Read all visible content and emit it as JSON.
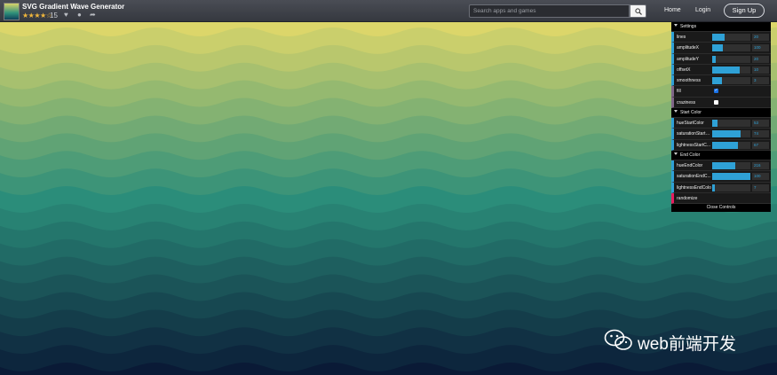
{
  "app": {
    "title": "SVG Gradient Wave Generator",
    "stars": "★★★★☆",
    "rating_count": "15",
    "icons": [
      "heart-icon",
      "info-icon",
      "share-icon"
    ]
  },
  "search": {
    "placeholder": "Search apps and games"
  },
  "nav": {
    "home": "Home",
    "login": "Login",
    "signup": "Sign Up"
  },
  "waves": {
    "count": 20,
    "start_color": "#dcd66a",
    "mid_color": "#2b8d7a",
    "end_color": "#0a1a36"
  },
  "gui": {
    "settings": {
      "title": "Settings",
      "rows": [
        {
          "label": "lines",
          "value": "20",
          "fill": 0.32
        },
        {
          "label": "amplitudeX",
          "value": "100",
          "fill": 0.28
        },
        {
          "label": "amplitudeY",
          "value": "20",
          "fill": 0.1
        },
        {
          "label": "offsetX",
          "value": "10",
          "fill": 0.73
        },
        {
          "label": "smoothness",
          "value": "3",
          "fill": 0.25
        }
      ],
      "toggles": [
        {
          "label": "fill",
          "checked": true
        },
        {
          "label": "craziness",
          "checked": false
        }
      ]
    },
    "start_color": {
      "title": "Start Color",
      "rows": [
        {
          "label": "hueStartColor",
          "value": "53",
          "fill": 0.14
        },
        {
          "label": "saturationStartC...",
          "value": "74",
          "fill": 0.74
        },
        {
          "label": "lightnessStartC...",
          "value": "67",
          "fill": 0.67
        }
      ]
    },
    "end_color": {
      "title": "End Color",
      "rows": [
        {
          "label": "hueEndColor",
          "value": "216",
          "fill": 0.6
        },
        {
          "label": "saturationEndC...",
          "value": "100",
          "fill": 1.0
        },
        {
          "label": "lightnessEndColo",
          "value": "7",
          "fill": 0.07
        }
      ]
    },
    "randomize": "randomize",
    "close": "Close Controls"
  },
  "watermark": "web前端开发"
}
